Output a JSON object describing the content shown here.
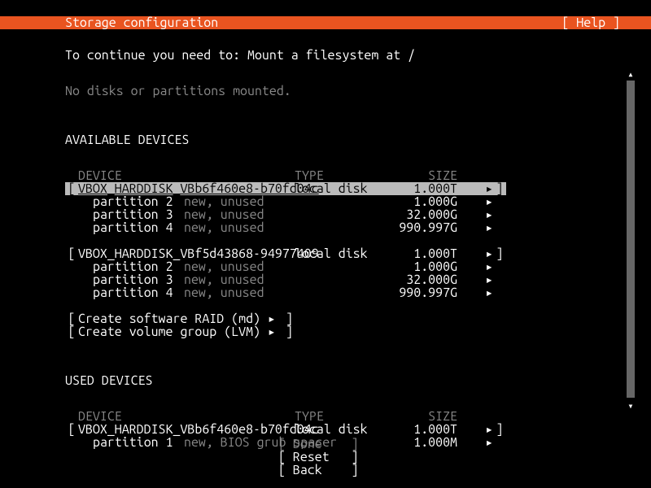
{
  "header": {
    "title": "Storage configuration",
    "help": "[ Help ]"
  },
  "prompt": "To continue you need to: Mount a filesystem at /",
  "mounted_msg": "No disks or partitions mounted.",
  "available_title": "AVAILABLE DEVICES",
  "used_title": "USED DEVICES",
  "cols": {
    "device": "DEVICE",
    "type": "TYPE",
    "size": "SIZE"
  },
  "arrow": "▸",
  "br_l": "[",
  "br_r": "]",
  "disk1": {
    "name": "VBOX_HARDDISK_VBb6f460e8-b70fd04c",
    "type": "local disk",
    "size": "1.000T",
    "parts": [
      {
        "name": "partition 2",
        "status": "new, unused",
        "size": "1.000G"
      },
      {
        "name": "partition 3",
        "status": "new, unused",
        "size": "32.000G"
      },
      {
        "name": "partition 4",
        "status": "new, unused",
        "size": "990.997G"
      }
    ]
  },
  "disk2": {
    "name": "VBOX_HARDDISK_VBf5d43868-94977409",
    "type": "local disk",
    "size": "1.000T",
    "parts": [
      {
        "name": "partition 2",
        "status": "new, unused",
        "size": "1.000G"
      },
      {
        "name": "partition 3",
        "status": "new, unused",
        "size": "32.000G"
      },
      {
        "name": "partition 4",
        "status": "new, unused",
        "size": "990.997G"
      }
    ]
  },
  "create_raid": "Create software RAID (md)",
  "create_lvm": "Create volume group (LVM)",
  "used_disk": {
    "name": "VBOX_HARDDISK_VBb6f460e8-b70fd04c",
    "type": "local disk",
    "size": "1.000T",
    "parts": [
      {
        "name": "partition 1",
        "status": "new, BIOS grub spacer",
        "size": "1.000M"
      }
    ]
  },
  "buttons": {
    "done": "Done",
    "reset": "Reset",
    "back": "Back"
  }
}
